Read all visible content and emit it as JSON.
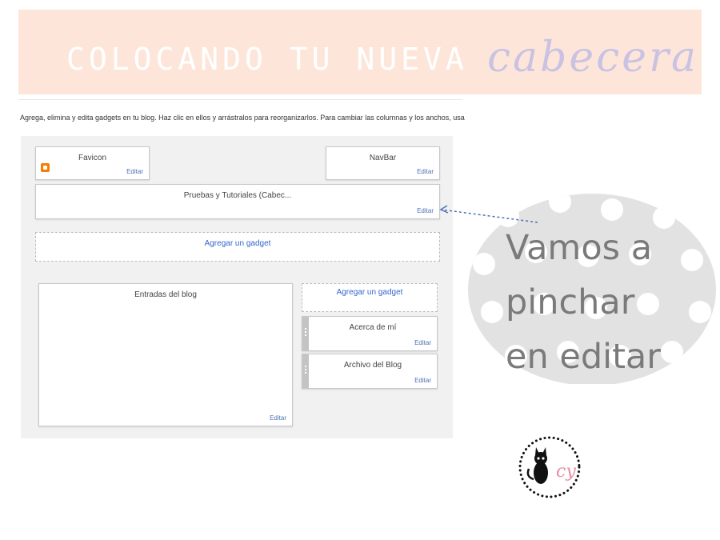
{
  "banner": {
    "title_caps": "COLOCANDO TU NUEVA",
    "title_script": "cabecera",
    "colors": {
      "background": "#fde6d9",
      "caps_text": "#ffffff",
      "script_text": "#c9c2e3"
    }
  },
  "instructions": "Agrega, elimina y edita gadgets en tu blog. Haz clic en ellos y arrástralos para reorganizarlos. Para cambiar las columnas y los anchos, usa el",
  "layout": {
    "edit_label": "Editar",
    "add_gadget_label": "Agregar un gadget",
    "gadgets": {
      "favicon": "Favicon",
      "navbar": "NavBar",
      "header": "Pruebas y Tutoriales (Cabec...",
      "blog_posts": "Entradas del blog",
      "about_me": "Acerca de mí",
      "blog_archive": "Archivo del Blog"
    },
    "colors": {
      "link": "#3366cc",
      "panel": "#f1f1f1"
    }
  },
  "callout": {
    "text": "Vamos a\npinchar\nen editar",
    "colors": {
      "bubble": "#e2e2e2",
      "arrow": "#4d73b3"
    }
  },
  "logo": {
    "icon": "cat-logo-icon",
    "monogram": "cy"
  }
}
